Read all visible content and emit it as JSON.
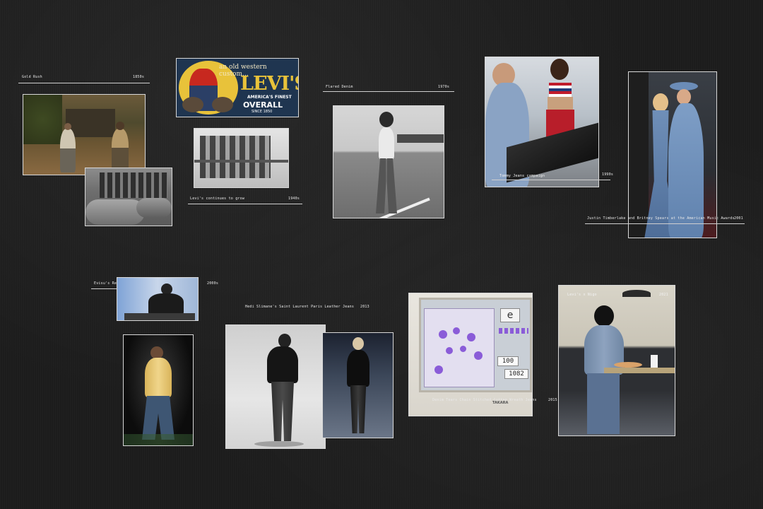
{
  "captions": {
    "gold_rush": {
      "title": "Gold Rush",
      "year": "1850s"
    },
    "levis_cowboys": {
      "title": "Levi's continues to grow",
      "year": "1940s"
    },
    "flared_denim": {
      "title": "Flared Denim",
      "year": "1970s"
    },
    "tommy_jeans": {
      "title": "Tommy Jeans campaign",
      "year": "1990s"
    },
    "timberlake_spears": {
      "title": "Justin Timberlake and Britney Spears at the American Music Awards",
      "year": "2001"
    },
    "evisu": {
      "title": "Evisu's Rebirth",
      "year": "2000s"
    },
    "saint_laurent": {
      "title": "Hedi Slimane's Saint Laurent Paris Leather Jeans",
      "year": "2013"
    },
    "denim_tears": {
      "title": "Denim Tears Chain Stitched Cotton Wreath Jeans",
      "year": "2015"
    },
    "levis_nigo": {
      "title": "Levi's x Nigo",
      "year": "2021"
    }
  },
  "levis_ad": {
    "tagline": "an old western custom...",
    "brand": "LEVI'S",
    "line1": "AMERICA'S FINEST",
    "line2": "OVERALL",
    "since": "SINCE 1850"
  },
  "computer": {
    "tab_letter": "e",
    "value_1": "100",
    "value_2": "1082",
    "maker": "TAKARA"
  },
  "colors": {
    "background": "#1c1c1c",
    "caption": "#e9e9e9",
    "ad_yellow": "#e8c23a",
    "ad_red": "#c7281f",
    "ad_navy": "#1f3550",
    "screen_purple": "#8a5cd8",
    "screen_bg": "#c9cfd6"
  }
}
